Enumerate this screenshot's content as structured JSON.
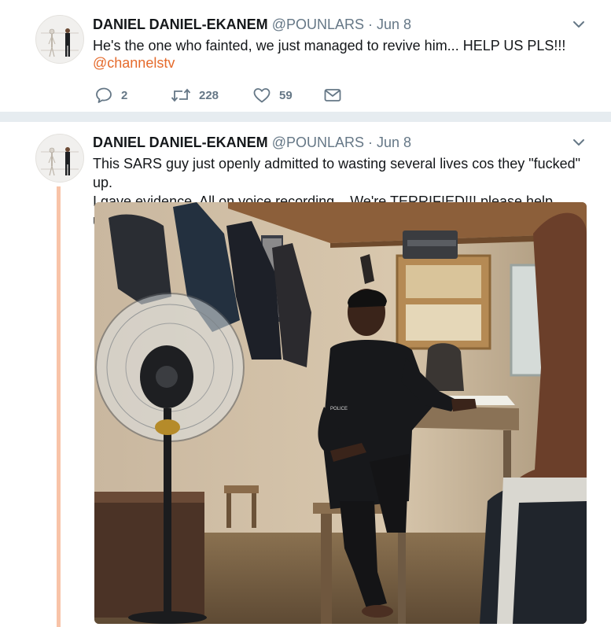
{
  "colors": {
    "accent": "#e56a2b",
    "thread_line": "#f8c3a8",
    "muted": "#657786"
  },
  "tweets": [
    {
      "name": "DANIEL DANIEL-EKANEM",
      "handle": "@POUNLARS",
      "date": "Jun 8",
      "text": "He's the one who fainted, we just managed to revive him... HELP US PLS!!!",
      "mention": "@channelstv",
      "replies": "2",
      "retweets": "228",
      "likes": "59",
      "icons": [
        "reply-icon",
        "retweet-icon",
        "heart-icon",
        "envelope-icon"
      ]
    },
    {
      "name": "DANIEL DANIEL-EKANEM",
      "handle": "@POUNLARS",
      "date": "Jun 8",
      "text_line1": "This SARS guy just openly admitted to wasting several lives cos they \"fucked\" up.",
      "text_line2": "I gave evidence. All on voice recording... We're TERRIFIED!!! please help us...",
      "photo_shirt_text": "POLICE"
    }
  ]
}
